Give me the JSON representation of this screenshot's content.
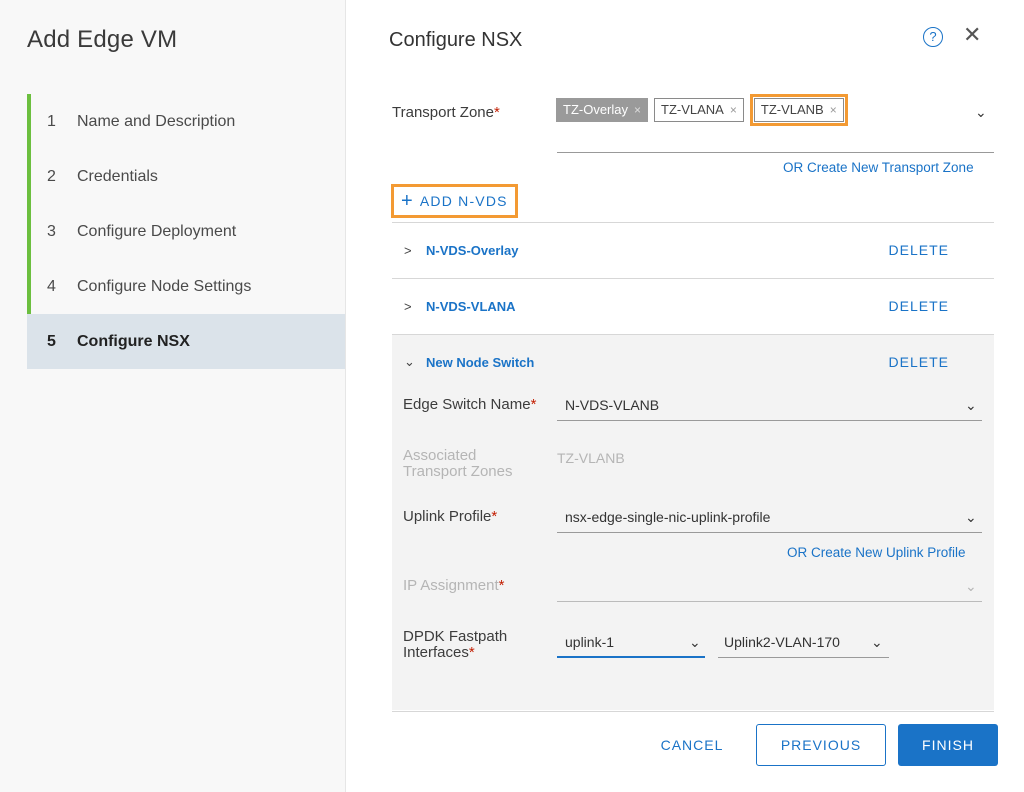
{
  "wizard": {
    "title": "Add Edge VM",
    "steps": [
      {
        "num": "1",
        "label": "Name and Description"
      },
      {
        "num": "2",
        "label": "Credentials"
      },
      {
        "num": "3",
        "label": "Configure Deployment"
      },
      {
        "num": "4",
        "label": "Configure Node Settings"
      },
      {
        "num": "5",
        "label": "Configure NSX"
      }
    ],
    "active_step": 5,
    "accent_color": "#6cbf3f"
  },
  "page": {
    "title": "Configure NSX",
    "help_icon": "?",
    "close_icon": "✕"
  },
  "transport_zone": {
    "label": "Transport Zone",
    "required_mark": "*",
    "chips": [
      "TZ-Overlay",
      "TZ-VLANA",
      "TZ-VLANB"
    ],
    "remove_glyph": "×",
    "caret": "⌄",
    "create_link": "OR Create New Transport Zone"
  },
  "add_nvds": {
    "plus": "+",
    "label": "ADD N-VDS"
  },
  "nvds_list": [
    {
      "chevron": ">",
      "name": "N-VDS-Overlay",
      "delete": "DELETE"
    },
    {
      "chevron": ">",
      "name": "N-VDS-VLANA",
      "delete": "DELETE"
    },
    {
      "chevron": "⌄",
      "name": "New Node Switch",
      "delete": "DELETE"
    }
  ],
  "node_switch": {
    "edge_switch_label": "Edge Switch Name",
    "edge_switch_value": "N-VDS-VLANB",
    "assoc_label_1": "Associated",
    "assoc_label_2": "Transport Zones",
    "assoc_value": "TZ-VLANB",
    "uplink_label": "Uplink Profile",
    "uplink_value": "nsx-edge-single-nic-uplink-profile",
    "uplink_create_link": "OR Create New Uplink Profile",
    "ip_label": "IP Assignment",
    "dpdk_label_1": "DPDK Fastpath",
    "dpdk_label_2": "Interfaces",
    "dpdk_value_1": "uplink-1",
    "dpdk_value_2": "Uplink2-VLAN-170",
    "required_mark": "*",
    "caret": "⌄"
  },
  "footer": {
    "cancel": "CANCEL",
    "previous": "PREVIOUS",
    "finish": "FINISH"
  },
  "colors": {
    "primary": "#1a73c7",
    "highlight": "#f39a33",
    "required": "#c21d00"
  }
}
